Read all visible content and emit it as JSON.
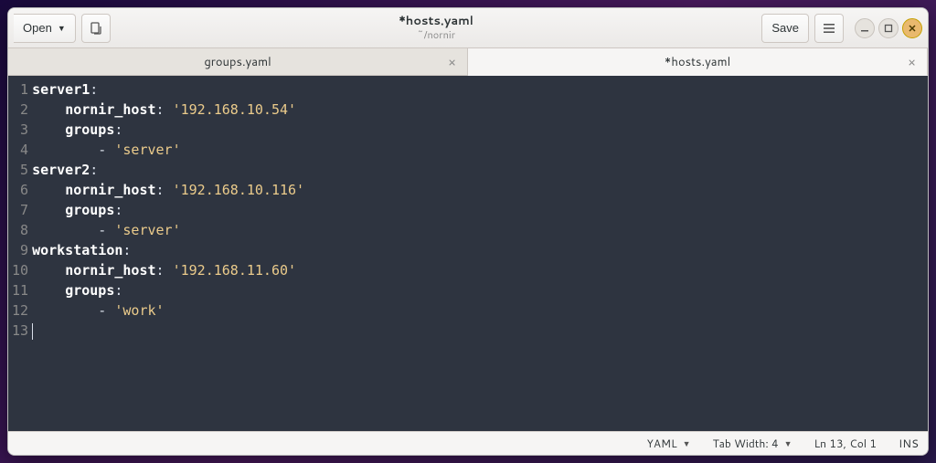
{
  "window": {
    "title": "*hosts.yaml",
    "subtitle": "~/nornir"
  },
  "toolbar": {
    "open_label": "Open",
    "save_label": "Save"
  },
  "tabs": [
    {
      "label": "groups.yaml",
      "active": false
    },
    {
      "label": "*hosts.yaml",
      "active": true
    }
  ],
  "code": {
    "lines": [
      {
        "n": 1,
        "segments": [
          {
            "t": "server1",
            "c": "key"
          },
          {
            "t": ":",
            "c": "colon"
          }
        ]
      },
      {
        "n": 2,
        "segments": [
          {
            "t": "    ",
            "c": ""
          },
          {
            "t": "nornir_host",
            "c": "key"
          },
          {
            "t": ": ",
            "c": "colon"
          },
          {
            "t": "'192.168.10.54'",
            "c": "str"
          }
        ]
      },
      {
        "n": 3,
        "segments": [
          {
            "t": "    ",
            "c": ""
          },
          {
            "t": "groups",
            "c": "key"
          },
          {
            "t": ":",
            "c": "colon"
          }
        ]
      },
      {
        "n": 4,
        "segments": [
          {
            "t": "        - ",
            "c": "dash"
          },
          {
            "t": "'server'",
            "c": "str"
          }
        ]
      },
      {
        "n": 5,
        "segments": [
          {
            "t": "server2",
            "c": "key"
          },
          {
            "t": ":",
            "c": "colon"
          }
        ]
      },
      {
        "n": 6,
        "segments": [
          {
            "t": "    ",
            "c": ""
          },
          {
            "t": "nornir_host",
            "c": "key"
          },
          {
            "t": ": ",
            "c": "colon"
          },
          {
            "t": "'192.168.10.116'",
            "c": "str"
          }
        ]
      },
      {
        "n": 7,
        "segments": [
          {
            "t": "    ",
            "c": ""
          },
          {
            "t": "groups",
            "c": "key"
          },
          {
            "t": ":",
            "c": "colon"
          }
        ]
      },
      {
        "n": 8,
        "segments": [
          {
            "t": "        - ",
            "c": "dash"
          },
          {
            "t": "'server'",
            "c": "str"
          }
        ]
      },
      {
        "n": 9,
        "segments": [
          {
            "t": "workstation",
            "c": "key"
          },
          {
            "t": ":",
            "c": "colon"
          }
        ]
      },
      {
        "n": 10,
        "segments": [
          {
            "t": "    ",
            "c": ""
          },
          {
            "t": "nornir_host",
            "c": "key"
          },
          {
            "t": ": ",
            "c": "colon"
          },
          {
            "t": "'192.168.11.60'",
            "c": "str"
          }
        ]
      },
      {
        "n": 11,
        "segments": [
          {
            "t": "    ",
            "c": ""
          },
          {
            "t": "groups",
            "c": "key"
          },
          {
            "t": ":",
            "c": "colon"
          }
        ]
      },
      {
        "n": 12,
        "segments": [
          {
            "t": "        - ",
            "c": "dash"
          },
          {
            "t": "'work'",
            "c": "str"
          }
        ]
      },
      {
        "n": 13,
        "segments": []
      }
    ]
  },
  "status": {
    "language": "YAML",
    "tab_width_label": "Tab Width: 4",
    "position": "Ln 13, Col 1",
    "insert_mode": "INS"
  }
}
